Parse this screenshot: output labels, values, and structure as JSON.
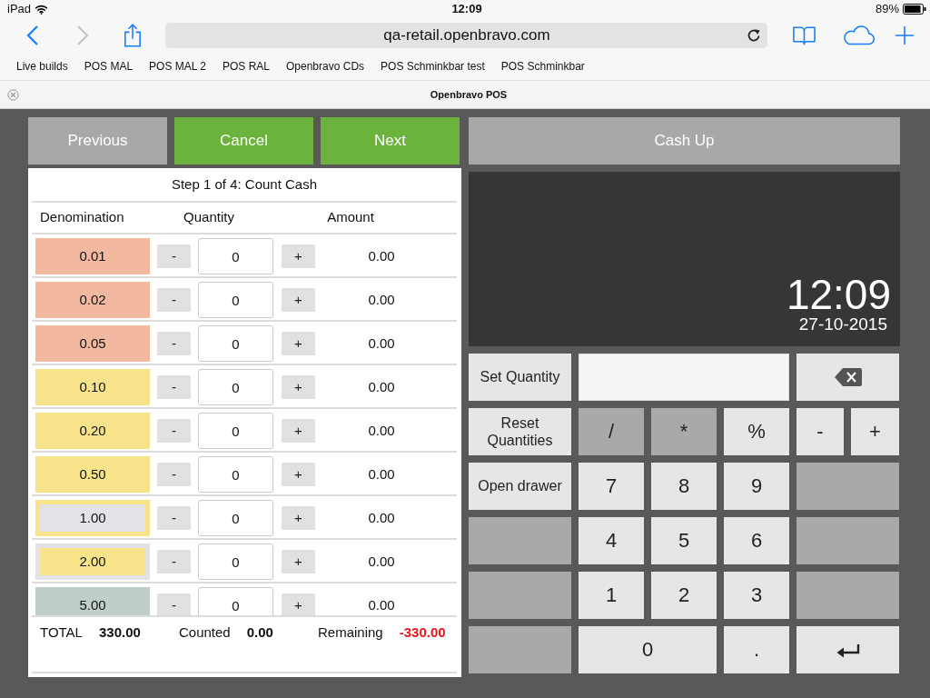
{
  "status_bar": {
    "device": "iPad",
    "time": "12:09",
    "battery": "89%"
  },
  "browser": {
    "nav": [
      {
        "kind": "back",
        "disabled": false
      },
      {
        "kind": "forward",
        "disabled": true
      }
    ],
    "url": "qa-retail.openbravo.com",
    "bookmarks": [
      "Live builds",
      "POS MAL",
      "POS MAL 2",
      "POS RAL",
      "Openbravo CDs",
      "POS Schminkbar test",
      "POS Schminkbar"
    ],
    "tab_title": "Openbravo POS"
  },
  "pos": {
    "nav_buttons": [
      {
        "label": "Previous",
        "disabled": true
      },
      {
        "label": "Cancel",
        "disabled": false
      },
      {
        "label": "Next",
        "disabled": false
      }
    ],
    "title": "Cash Up",
    "count": {
      "step": "Step 1 of 4: Count Cash",
      "columns": [
        "Denomination",
        "Quantity",
        "Amount"
      ],
      "rows": [
        {
          "denomination": "0.01",
          "color": "#f2b9a0",
          "decrement": "-",
          "quantity": "0",
          "increment": "+",
          "amount": "0.00"
        },
        {
          "denomination": "0.02",
          "color": "#f2b9a0",
          "decrement": "-",
          "quantity": "0",
          "increment": "+",
          "amount": "0.00"
        },
        {
          "denomination": "0.05",
          "color": "#f2b9a0",
          "decrement": "-",
          "quantity": "0",
          "increment": "+",
          "amount": "0.00"
        },
        {
          "denomination": "0.10",
          "color": "#f8e38b",
          "decrement": "-",
          "quantity": "0",
          "increment": "+",
          "amount": "0.00"
        },
        {
          "denomination": "0.20",
          "color": "#f8e38b",
          "decrement": "-",
          "quantity": "0",
          "increment": "+",
          "amount": "0.00"
        },
        {
          "denomination": "0.50",
          "color": "#f8e38b",
          "decrement": "-",
          "quantity": "0",
          "increment": "+",
          "amount": "0.00"
        },
        {
          "denomination": "1.00",
          "color": "#f8e38b",
          "inner": {
            "color": "#e4e2e6"
          },
          "decrement": "-",
          "quantity": "0",
          "increment": "+",
          "amount": "0.00"
        },
        {
          "denomination": "2.00",
          "color": "#e4e2e6",
          "inner": {
            "color": "#f8e38b"
          },
          "decrement": "-",
          "quantity": "0",
          "increment": "+",
          "amount": "0.00"
        },
        {
          "denomination": "5.00",
          "color": "#bfcfc8",
          "decrement": "-",
          "quantity": "0",
          "increment": "+",
          "amount": "0.00"
        }
      ],
      "totals": [
        {
          "label": "TOTAL",
          "value": "330.00",
          "negative": false
        },
        {
          "label": "Counted",
          "value": "0.00",
          "negative": false
        },
        {
          "label": "Remaining",
          "value": "-330.00",
          "negative": true
        }
      ]
    },
    "display": {
      "time": "12:09",
      "date": "27-10-2015"
    },
    "keypad": {
      "rows": [
        [
          {
            "kind": "action",
            "label": "Set Quantity",
            "disabled": false
          },
          {
            "kind": "field"
          },
          "",
          "",
          {
            "kind": "backspace",
            "disabled": false
          }
        ],
        [
          {
            "kind": "action",
            "label": "Reset Quantities",
            "disabled": false
          },
          {
            "kind": "key",
            "label": "/",
            "disabled": true
          },
          {
            "kind": "key",
            "label": "*",
            "disabled": true
          },
          {
            "kind": "key",
            "label": "%",
            "disabled": false
          },
          {
            "kind": "pair",
            "keys": [
              {
                "kind": "key",
                "label": "-",
                "disabled": false
              },
              {
                "kind": "key",
                "label": "+",
                "disabled": false
              }
            ]
          }
        ],
        [
          {
            "kind": "action",
            "label": "Open drawer",
            "disabled": false
          },
          {
            "kind": "key",
            "label": "7",
            "disabled": false
          },
          {
            "kind": "key",
            "label": "8",
            "disabled": false
          },
          {
            "kind": "key",
            "label": "9",
            "disabled": false
          },
          {
            "kind": "key",
            "disabled": true
          }
        ],
        [
          {
            "kind": "action",
            "disabled": true
          },
          {
            "kind": "key",
            "label": "4",
            "disabled": false
          },
          {
            "kind": "key",
            "label": "5",
            "disabled": false
          },
          {
            "kind": "key",
            "label": "6",
            "disabled": false
          },
          {
            "kind": "key",
            "disabled": true
          }
        ],
        [
          {
            "kind": "action",
            "disabled": true
          },
          {
            "kind": "key",
            "label": "1",
            "disabled": false
          },
          {
            "kind": "key",
            "label": "2",
            "disabled": false
          },
          {
            "kind": "key",
            "label": "3",
            "disabled": false
          },
          {
            "kind": "key",
            "disabled": true
          }
        ],
        [
          {
            "kind": "action",
            "disabled": true
          },
          {
            "kind": "key",
            "label": "0",
            "disabled": false
          },
          "",
          {
            "kind": "key",
            "label": ".",
            "disabled": false
          },
          {
            "kind": "enter",
            "disabled": false
          }
        ]
      ]
    }
  }
}
